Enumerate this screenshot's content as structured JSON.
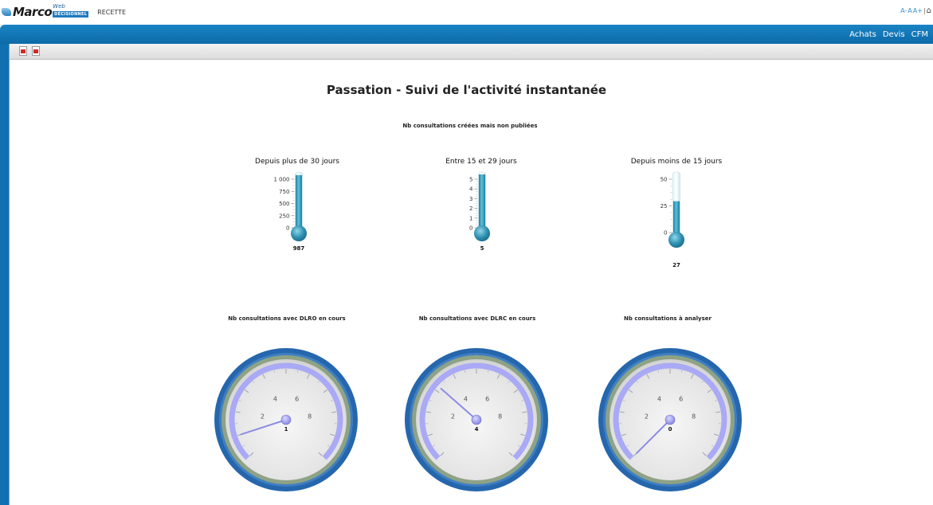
{
  "app": {
    "logo_text": "Marco",
    "logo_web": "Web",
    "logo_badge": "DÉCISIONNEL",
    "environment": "RECETTE",
    "font_controls": [
      "A-",
      "A",
      "A+"
    ]
  },
  "nav": {
    "links": [
      "Achats",
      "Devis",
      "CFM"
    ]
  },
  "toolbar": {
    "icons": [
      "pdf-export-icon",
      "powerpoint-export-icon"
    ]
  },
  "report": {
    "title": "Passation - Suivi de l'activité instantanée",
    "thermo_section_title": "Nb consultations créées mais non publiées"
  },
  "thermometers": [
    {
      "title": "Depuis plus de 30 jours",
      "value": 987,
      "value_label": "987",
      "max": 1000,
      "ticks": [
        "1 000",
        "750",
        "500",
        "250",
        "0"
      ],
      "fill_color": "#2f94b4"
    },
    {
      "title": "Entre 15 et 29 jours",
      "value": 5,
      "value_label": "5",
      "max": 5,
      "ticks": [
        "5",
        "4",
        "3",
        "2",
        "1",
        "0"
      ],
      "fill_color": "#2f94b4"
    },
    {
      "title": "Depuis moins de 15 jours",
      "value": 27,
      "value_label": "27",
      "max": 50,
      "ticks": [
        "50",
        "25",
        "0"
      ],
      "fill_color": "#2f94b4"
    }
  ],
  "gauges": [
    {
      "title": "Nb consultations avec DLRO en cours",
      "value": 1,
      "value_label": "1",
      "needle_value": 1,
      "labels": [
        "2",
        "4",
        "6",
        "8"
      ]
    },
    {
      "title": "Nb consultations avec DLRC en cours",
      "value": 4,
      "value_label": "4",
      "needle_value": 3.2,
      "labels": [
        "2",
        "4",
        "6",
        "8"
      ]
    },
    {
      "title": "Nb consultations à analyser",
      "value": 0,
      "value_label": "0",
      "needle_value": 0,
      "labels": [
        "2",
        "4",
        "6",
        "8"
      ]
    }
  ],
  "colors": {
    "nav_blue": "#1479bb",
    "gauge_ring": "#2463a8",
    "gauge_band": "#8a9f7c",
    "gauge_arc": "#a8a8f4",
    "needle": "#8888e8"
  }
}
